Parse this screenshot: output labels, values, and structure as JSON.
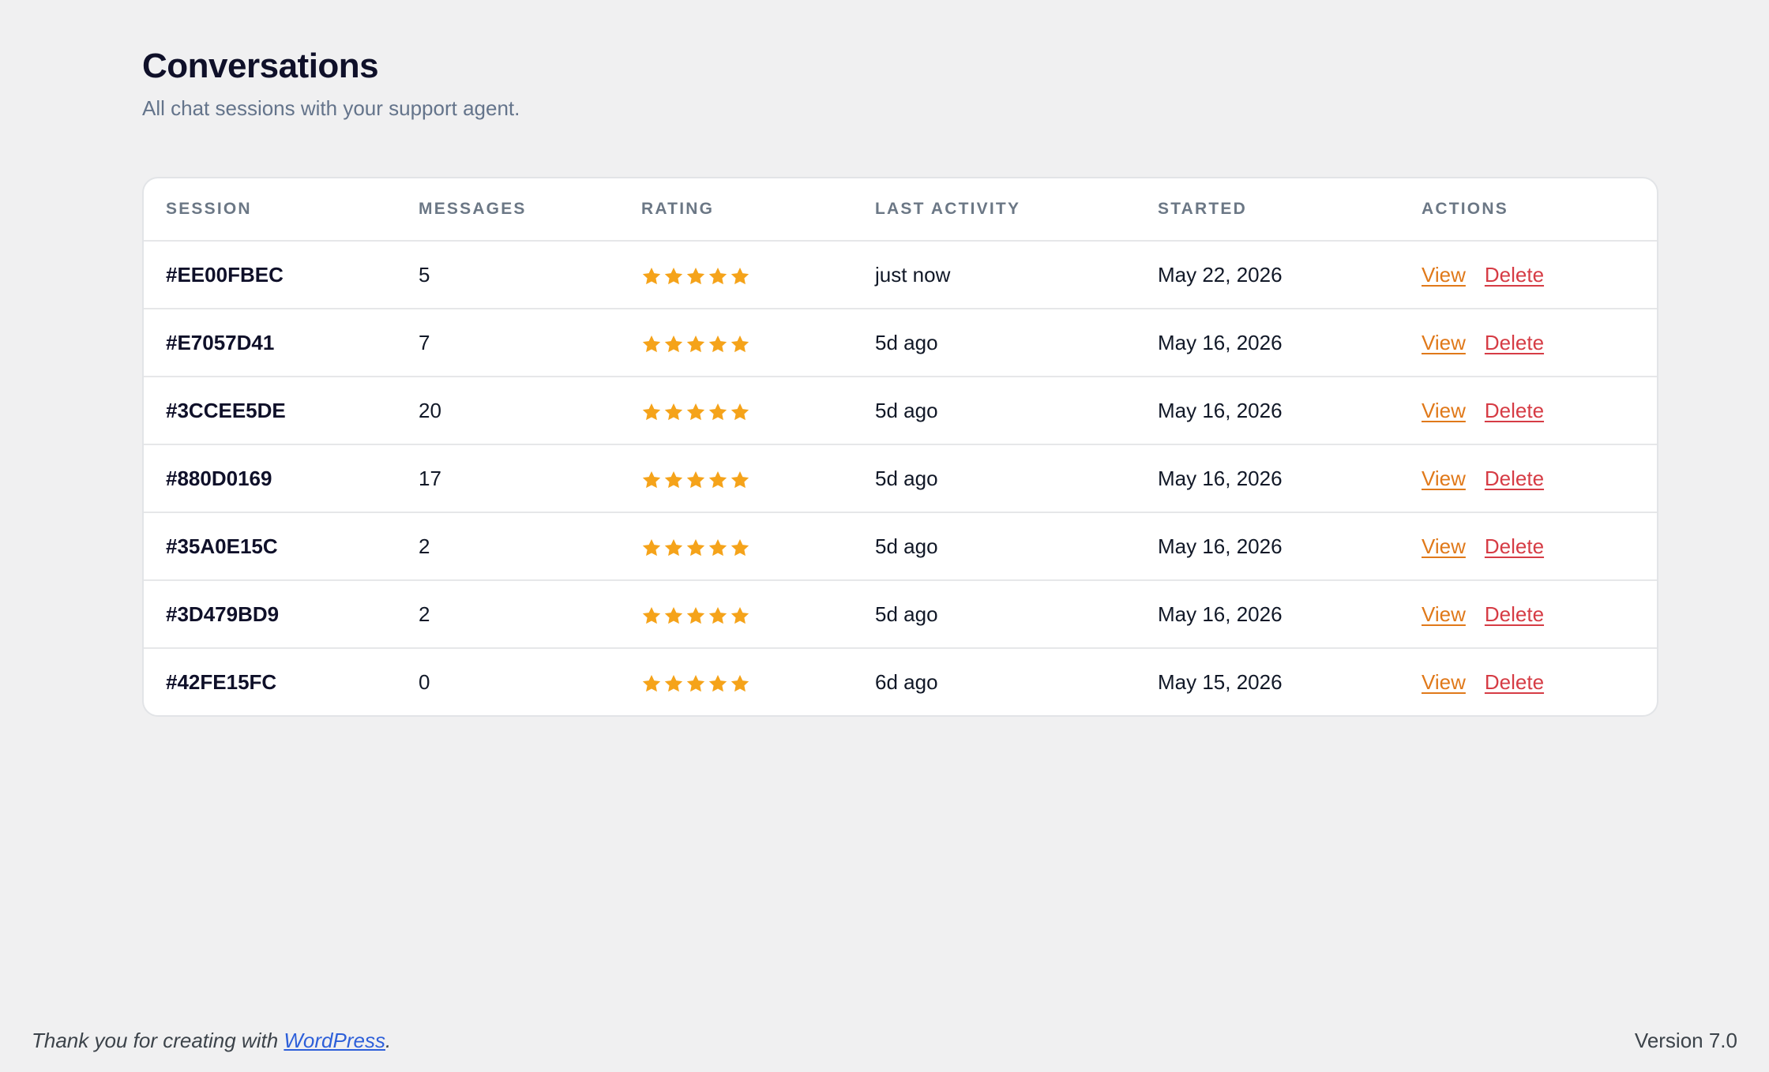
{
  "header": {
    "title": "Conversations",
    "subtitle": "All chat sessions with your support agent."
  },
  "table": {
    "columns": [
      "SESSION",
      "MESSAGES",
      "RATING",
      "LAST ACTIVITY",
      "STARTED",
      "ACTIONS"
    ],
    "rows": [
      {
        "session": "#EE00FBEC",
        "messages": "5",
        "rating": 5,
        "last_activity": "just now",
        "started": "May 22, 2026",
        "view": "View",
        "delete": "Delete"
      },
      {
        "session": "#E7057D41",
        "messages": "7",
        "rating": 5,
        "last_activity": "5d ago",
        "started": "May 16, 2026",
        "view": "View",
        "delete": "Delete"
      },
      {
        "session": "#3CCEE5DE",
        "messages": "20",
        "rating": 5,
        "last_activity": "5d ago",
        "started": "May 16, 2026",
        "view": "View",
        "delete": "Delete"
      },
      {
        "session": "#880D0169",
        "messages": "17",
        "rating": 5,
        "last_activity": "5d ago",
        "started": "May 16, 2026",
        "view": "View",
        "delete": "Delete"
      },
      {
        "session": "#35A0E15C",
        "messages": "2",
        "rating": 5,
        "last_activity": "5d ago",
        "started": "May 16, 2026",
        "view": "View",
        "delete": "Delete"
      },
      {
        "session": "#3D479BD9",
        "messages": "2",
        "rating": 5,
        "last_activity": "5d ago",
        "started": "May 16, 2026",
        "view": "View",
        "delete": "Delete"
      },
      {
        "session": "#42FE15FC",
        "messages": "0",
        "rating": 5,
        "last_activity": "6d ago",
        "started": "May 15, 2026",
        "view": "View",
        "delete": "Delete"
      }
    ]
  },
  "footer": {
    "thanks_prefix": "Thank you for creating with ",
    "wordpress_link": "WordPress",
    "thanks_suffix": ".",
    "version": "Version 7.0"
  },
  "colors": {
    "background": "#f0f0f1",
    "star": "#f5a31a",
    "view_link": "#e0791a",
    "delete_link": "#d63c45",
    "footer_link": "#2d5fd9"
  },
  "icons": {
    "rating_star": "star-icon"
  }
}
